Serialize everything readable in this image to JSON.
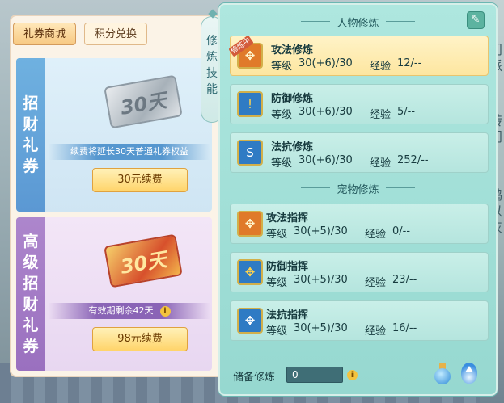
{
  "shop": {
    "tabs": [
      "礼券商城",
      "积分兑换"
    ],
    "cards": [
      {
        "side_title": "招财礼券",
        "ticket_text": "30天",
        "ribbon": "续费将延长30天普通礼券权益",
        "button": "30元续费"
      },
      {
        "side_title": "高级招财礼券",
        "ticket_text": "30天",
        "ribbon": "有效期剩余42天",
        "button": "98元续费"
      }
    ]
  },
  "vertical_tab": "修炼技能",
  "panel": {
    "section1_title": "人物修炼",
    "section2_title": "宠物修炼",
    "level_label": "等级",
    "exp_label": "经验",
    "active_tag": "修炼中",
    "person_skills": [
      {
        "name": "攻法修炼",
        "level": "30(+6)/30",
        "exp": "12/--",
        "icon": "paw-icon",
        "active": true
      },
      {
        "name": "防御修炼",
        "level": "30(+6)/30",
        "exp": "5/--",
        "icon": "shield-icon",
        "active": false
      },
      {
        "name": "法抗修炼",
        "level": "30(+6)/30",
        "exp": "252/--",
        "icon": "swirl-shield-icon",
        "active": false
      }
    ],
    "pet_skills": [
      {
        "name": "攻法指挥",
        "level": "30(+5)/30",
        "exp": "0/--",
        "icon": "paw-icon"
      },
      {
        "name": "防御指挥",
        "level": "30(+5)/30",
        "exp": "23/--",
        "icon": "paw-shield-icon"
      },
      {
        "name": "法抗指挥",
        "level": "30(+5)/30",
        "exp": "16/--",
        "icon": "paw-shield-icon"
      }
    ],
    "reserve_label": "储备修炼",
    "reserve_value": "0",
    "info_glyph": "i"
  },
  "edge_text": [
    "门",
    "派",
    "转",
    "门",
    "鹤",
    "以",
    "灰"
  ]
}
